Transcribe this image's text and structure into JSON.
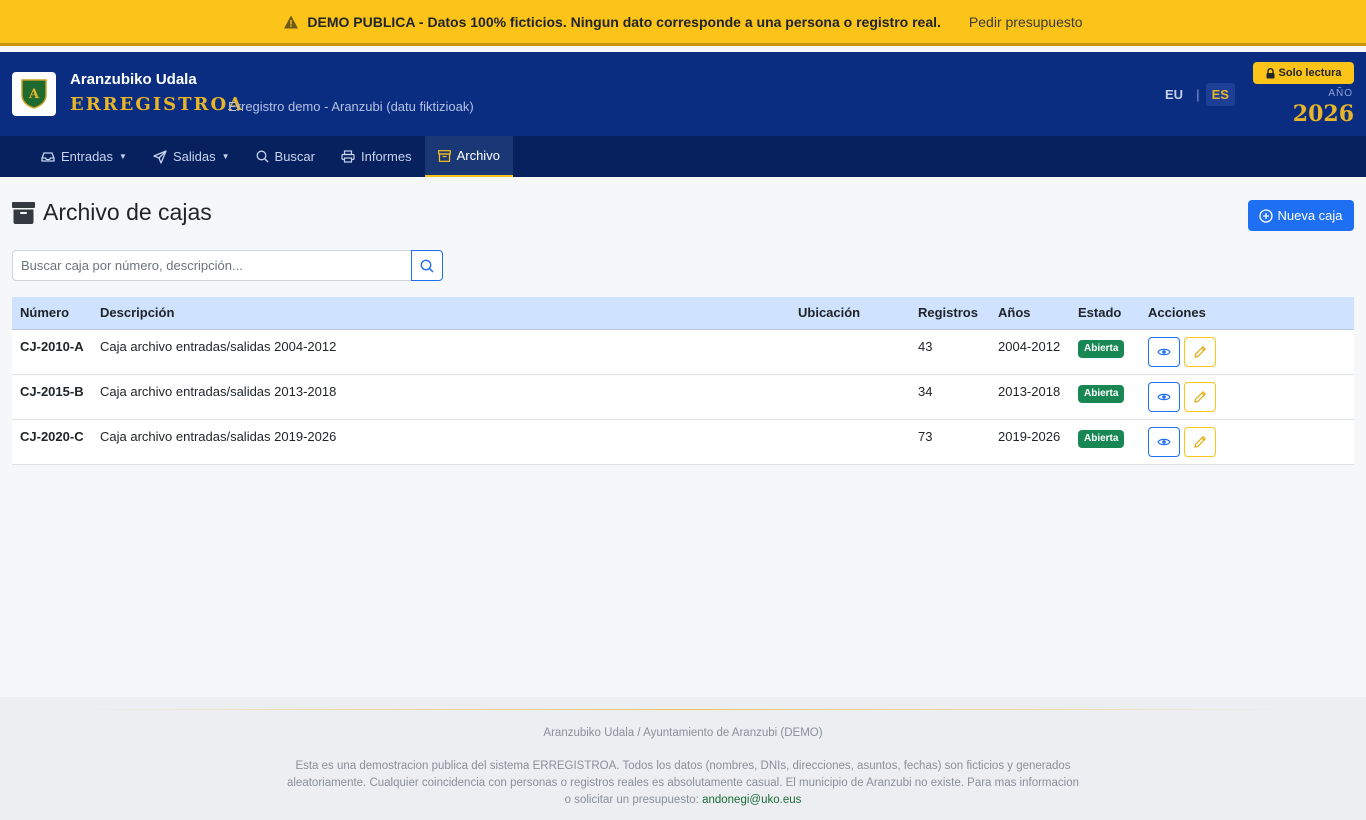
{
  "demo_banner": {
    "text": "DEMO PUBLICA - Datos 100% ficticios. Ningun dato corresponde a una persona o registro real.",
    "link": "Pedir presupuesto"
  },
  "header": {
    "logo_letter": "A",
    "org_name": "Aranzubiko Udala",
    "app_name": "ERREGISTROA",
    "app_subtitle": "Erregistro demo - Aranzubi (datu fiktizioak)",
    "lang_eu": "EU",
    "lang_sep": "|",
    "lang_es": "ES",
    "readonly_badge": "Solo lectura",
    "year_label": "AÑO",
    "year_value": "2026"
  },
  "nav": {
    "entradas": "Entradas",
    "salidas": "Salidas",
    "buscar": "Buscar",
    "informes": "Informes",
    "archivo": "Archivo"
  },
  "main": {
    "title": "Archivo de cajas",
    "new_button": "Nueva caja",
    "search_placeholder": "Buscar caja por número, descripción..."
  },
  "table": {
    "headers": {
      "numero": "Número",
      "descripcion": "Descripción",
      "ubicacion": "Ubicación",
      "registros": "Registros",
      "anos": "Años",
      "estado": "Estado",
      "acciones": "Acciones"
    },
    "rows": [
      {
        "numero": "CJ-2010-A",
        "descripcion": "Caja archivo entradas/salidas 2004-2012",
        "ubicacion": "",
        "registros": "43",
        "anos": "2004-2012",
        "estado": "Abierta"
      },
      {
        "numero": "CJ-2015-B",
        "descripcion": "Caja archivo entradas/salidas 2013-2018",
        "ubicacion": "",
        "registros": "34",
        "anos": "2013-2018",
        "estado": "Abierta"
      },
      {
        "numero": "CJ-2020-C",
        "descripcion": "Caja archivo entradas/salidas 2019-2026",
        "ubicacion": "",
        "registros": "73",
        "anos": "2019-2026",
        "estado": "Abierta"
      }
    ]
  },
  "footer": {
    "org": "Aranzubiko Udala / Ayuntamiento de Aranzubi (DEMO)",
    "disclaimer": "Esta es una demostracion publica del sistema ERREGISTROA. Todos los datos (nombres, DNIs, direcciones, asuntos, fechas) son ficticios y generados aleatoriamente. Cualquier coincidencia con personas o registros reales es absolutamente casual. El municipio de Aranzubi no existe. Para mas informacion o solicitar un presupuesto:",
    "email": "andonegi@uko.eus"
  },
  "colors": {
    "banner": "#fcc419",
    "header": "#0a2d82",
    "nav": "#06215e",
    "accent_gold": "#e8b528",
    "primary": "#1e6ff2",
    "success": "#198754"
  },
  "icons": {
    "banner": "warning-triangle-icon",
    "entradas": "inbox-icon",
    "salidas": "paper-plane-icon",
    "buscar": "search-icon",
    "informes": "printer-icon",
    "archivo": "archive-box-icon",
    "readonly": "lock-icon",
    "new": "plus-circle-icon",
    "view": "eye-icon",
    "edit": "pencil-icon"
  }
}
